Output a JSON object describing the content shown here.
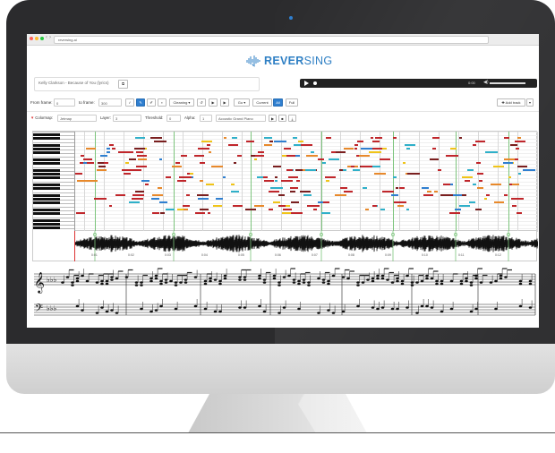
{
  "browser": {
    "url": "reversing.ai"
  },
  "app": {
    "logo_text_bold": "REVER",
    "logo_text_rest": "SING"
  },
  "song": {
    "title": "Kelly Clarkson - Because of You (lyrics)"
  },
  "player": {
    "time": "0:00"
  },
  "toolbar": {
    "from_label": "From frame:",
    "from_value": "0",
    "to_label": "to frame:",
    "to_value": "300",
    "cleaning_label": "Cleaning ▾",
    "go_label": "Go ▾",
    "current_label": "Current",
    "all_label": "All",
    "full_label": "Full",
    "add_track_label": "✚ Add track"
  },
  "toolbar2": {
    "colormap_label": "Colormap:",
    "colormap_value": "Jetmap",
    "layer_label": "Layer:",
    "layer_value": "3",
    "threshold_label": "Threshold:",
    "threshold_value": "0",
    "alpha_label": "Alpha:",
    "alpha_value": "1",
    "instrument_value": "Acoustic Grand Piano"
  },
  "timeline": {
    "ticks": [
      "0:01",
      "0:02",
      "0:03",
      "0:04",
      "0:05",
      "0:06",
      "0:07",
      "0:08",
      "0:09",
      "0:10",
      "0:11",
      "0:12"
    ]
  },
  "colors": {
    "accent": "#2f7fd0",
    "note_red": "#c0262b",
    "note_yellow": "#f0c419",
    "note_blue": "#2f7fd0",
    "guide_green": "#7cc47c"
  }
}
